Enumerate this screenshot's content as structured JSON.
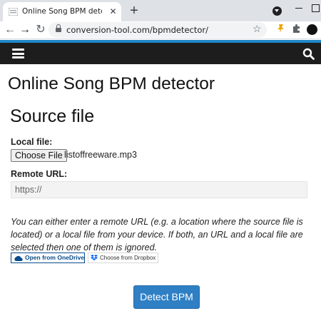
{
  "browser": {
    "tab_title": "Online Song BPM detector – Conv",
    "tab_close": "✕",
    "new_tab": "+",
    "url": "conversion-tool.com/bpmdetector/",
    "icons": [
      "favicon-icon",
      "tab-search-icon",
      "minimize-icon",
      "maximize-icon",
      "back-icon",
      "forward-icon",
      "reload-icon",
      "lock-icon",
      "star-icon",
      "extension-icon",
      "puzzle-icon",
      "profile-icon"
    ]
  },
  "site_nav": {
    "accent_color": "#1f88c9",
    "bar_color": "#1d1d1d",
    "icons": [
      "menu-icon",
      "search-icon"
    ]
  },
  "page": {
    "title": "Online Song BPM detector",
    "section_title": "Source file",
    "local_file_label": "Local file:",
    "choose_file_label": "Choose File",
    "file_name": "listoffreeware.mp3",
    "remote_url_label": "Remote URL:",
    "remote_url_placeholder": "https://",
    "help_text": "You can either enter a remote URL (e.g. a location where the source file is located) or a local file from your device. If both, an URL and a local file are selected then one of them is ignored.",
    "onedrive_label": "Open from OneDrive",
    "dropbox_label": "Choose from Dropbox",
    "detect_button": "Detect BPM",
    "detect_button_color": "#2f7fc5"
  }
}
